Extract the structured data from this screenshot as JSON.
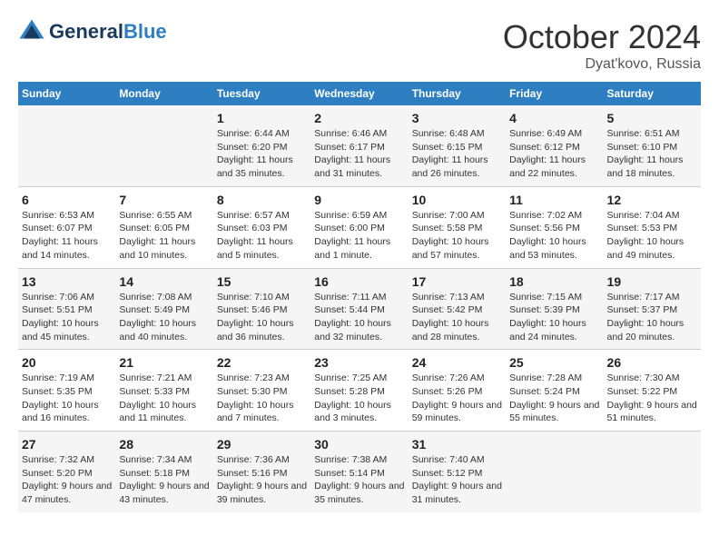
{
  "header": {
    "logo_line1": "General",
    "logo_line2": "Blue",
    "month": "October 2024",
    "location": "Dyat'kovo, Russia"
  },
  "weekdays": [
    "Sunday",
    "Monday",
    "Tuesday",
    "Wednesday",
    "Thursday",
    "Friday",
    "Saturday"
  ],
  "weeks": [
    [
      {
        "day": "",
        "info": ""
      },
      {
        "day": "",
        "info": ""
      },
      {
        "day": "1",
        "info": "Sunrise: 6:44 AM\nSunset: 6:20 PM\nDaylight: 11 hours\nand 35 minutes."
      },
      {
        "day": "2",
        "info": "Sunrise: 6:46 AM\nSunset: 6:17 PM\nDaylight: 11 hours\nand 31 minutes."
      },
      {
        "day": "3",
        "info": "Sunrise: 6:48 AM\nSunset: 6:15 PM\nDaylight: 11 hours\nand 26 minutes."
      },
      {
        "day": "4",
        "info": "Sunrise: 6:49 AM\nSunset: 6:12 PM\nDaylight: 11 hours\nand 22 minutes."
      },
      {
        "day": "5",
        "info": "Sunrise: 6:51 AM\nSunset: 6:10 PM\nDaylight: 11 hours\nand 18 minutes."
      }
    ],
    [
      {
        "day": "6",
        "info": "Sunrise: 6:53 AM\nSunset: 6:07 PM\nDaylight: 11 hours\nand 14 minutes."
      },
      {
        "day": "7",
        "info": "Sunrise: 6:55 AM\nSunset: 6:05 PM\nDaylight: 11 hours\nand 10 minutes."
      },
      {
        "day": "8",
        "info": "Sunrise: 6:57 AM\nSunset: 6:03 PM\nDaylight: 11 hours\nand 5 minutes."
      },
      {
        "day": "9",
        "info": "Sunrise: 6:59 AM\nSunset: 6:00 PM\nDaylight: 11 hours\nand 1 minute."
      },
      {
        "day": "10",
        "info": "Sunrise: 7:00 AM\nSunset: 5:58 PM\nDaylight: 10 hours\nand 57 minutes."
      },
      {
        "day": "11",
        "info": "Sunrise: 7:02 AM\nSunset: 5:56 PM\nDaylight: 10 hours\nand 53 minutes."
      },
      {
        "day": "12",
        "info": "Sunrise: 7:04 AM\nSunset: 5:53 PM\nDaylight: 10 hours\nand 49 minutes."
      }
    ],
    [
      {
        "day": "13",
        "info": "Sunrise: 7:06 AM\nSunset: 5:51 PM\nDaylight: 10 hours\nand 45 minutes."
      },
      {
        "day": "14",
        "info": "Sunrise: 7:08 AM\nSunset: 5:49 PM\nDaylight: 10 hours\nand 40 minutes."
      },
      {
        "day": "15",
        "info": "Sunrise: 7:10 AM\nSunset: 5:46 PM\nDaylight: 10 hours\nand 36 minutes."
      },
      {
        "day": "16",
        "info": "Sunrise: 7:11 AM\nSunset: 5:44 PM\nDaylight: 10 hours\nand 32 minutes."
      },
      {
        "day": "17",
        "info": "Sunrise: 7:13 AM\nSunset: 5:42 PM\nDaylight: 10 hours\nand 28 minutes."
      },
      {
        "day": "18",
        "info": "Sunrise: 7:15 AM\nSunset: 5:39 PM\nDaylight: 10 hours\nand 24 minutes."
      },
      {
        "day": "19",
        "info": "Sunrise: 7:17 AM\nSunset: 5:37 PM\nDaylight: 10 hours\nand 20 minutes."
      }
    ],
    [
      {
        "day": "20",
        "info": "Sunrise: 7:19 AM\nSunset: 5:35 PM\nDaylight: 10 hours\nand 16 minutes."
      },
      {
        "day": "21",
        "info": "Sunrise: 7:21 AM\nSunset: 5:33 PM\nDaylight: 10 hours\nand 11 minutes."
      },
      {
        "day": "22",
        "info": "Sunrise: 7:23 AM\nSunset: 5:30 PM\nDaylight: 10 hours\nand 7 minutes."
      },
      {
        "day": "23",
        "info": "Sunrise: 7:25 AM\nSunset: 5:28 PM\nDaylight: 10 hours\nand 3 minutes."
      },
      {
        "day": "24",
        "info": "Sunrise: 7:26 AM\nSunset: 5:26 PM\nDaylight: 9 hours\nand 59 minutes."
      },
      {
        "day": "25",
        "info": "Sunrise: 7:28 AM\nSunset: 5:24 PM\nDaylight: 9 hours\nand 55 minutes."
      },
      {
        "day": "26",
        "info": "Sunrise: 7:30 AM\nSunset: 5:22 PM\nDaylight: 9 hours\nand 51 minutes."
      }
    ],
    [
      {
        "day": "27",
        "info": "Sunrise: 7:32 AM\nSunset: 5:20 PM\nDaylight: 9 hours\nand 47 minutes."
      },
      {
        "day": "28",
        "info": "Sunrise: 7:34 AM\nSunset: 5:18 PM\nDaylight: 9 hours\nand 43 minutes."
      },
      {
        "day": "29",
        "info": "Sunrise: 7:36 AM\nSunset: 5:16 PM\nDaylight: 9 hours\nand 39 minutes."
      },
      {
        "day": "30",
        "info": "Sunrise: 7:38 AM\nSunset: 5:14 PM\nDaylight: 9 hours\nand 35 minutes."
      },
      {
        "day": "31",
        "info": "Sunrise: 7:40 AM\nSunset: 5:12 PM\nDaylight: 9 hours\nand 31 minutes."
      },
      {
        "day": "",
        "info": ""
      },
      {
        "day": "",
        "info": ""
      }
    ]
  ]
}
